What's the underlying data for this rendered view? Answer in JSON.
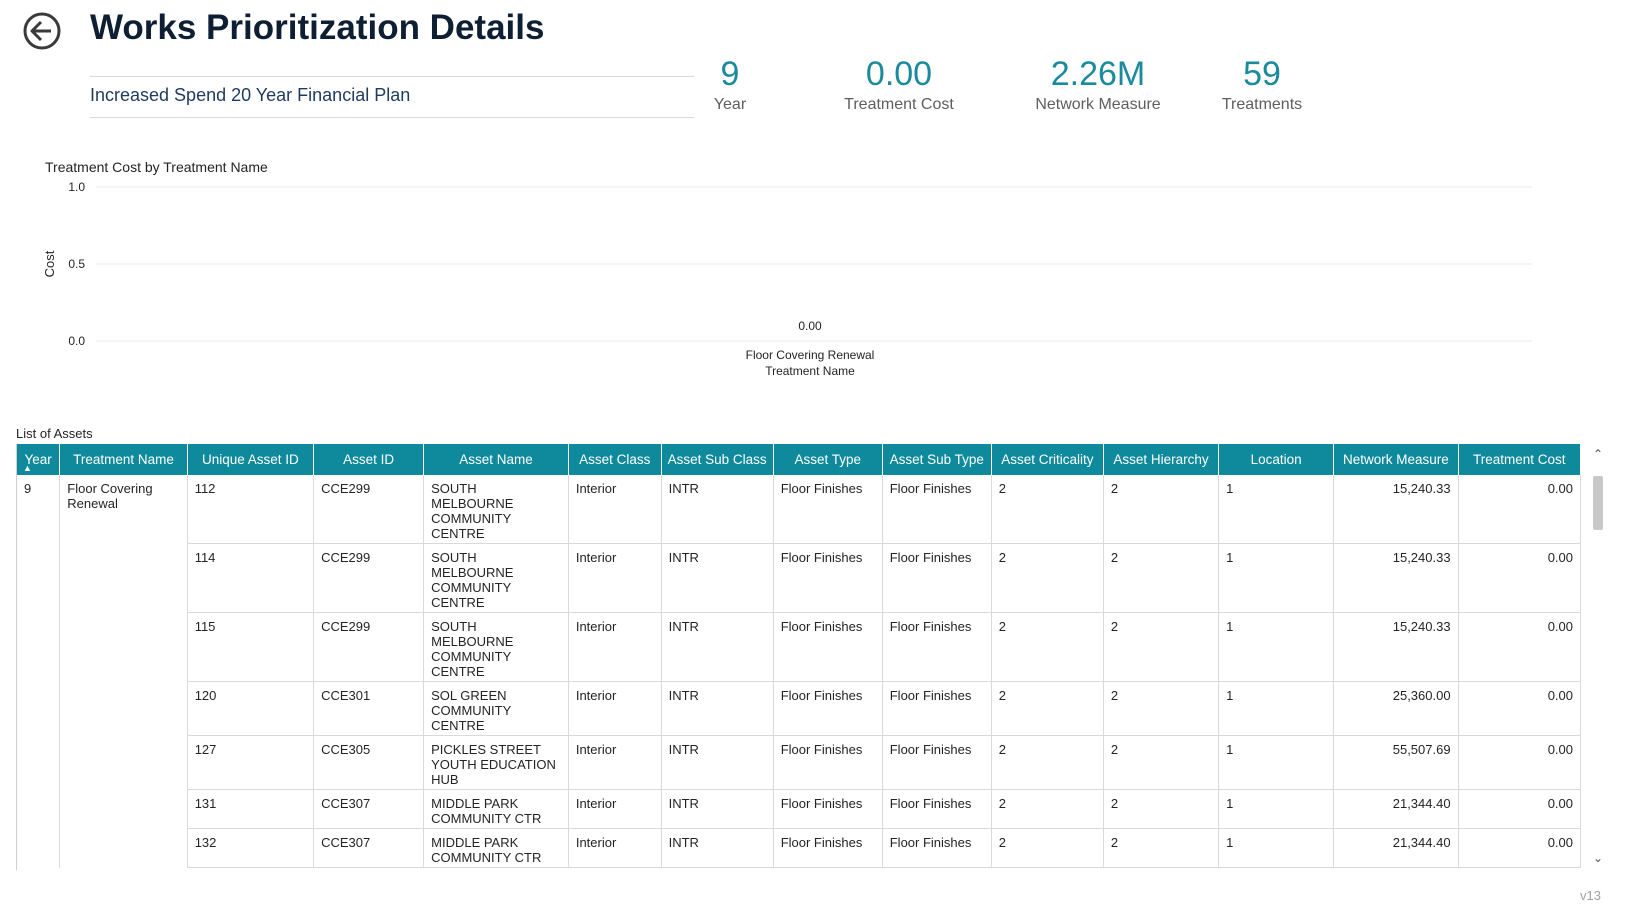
{
  "header": {
    "title": "Works Prioritization Details",
    "back_icon": "arrow-left-circle-icon",
    "scenario": "Increased Spend 20 Year Financial Plan"
  },
  "kpis": [
    {
      "value": "9",
      "label": "Year"
    },
    {
      "value": "0.00",
      "label": "Treatment Cost"
    },
    {
      "value": "2.26M",
      "label": "Network Measure"
    },
    {
      "value": "59",
      "label": "Treatments"
    }
  ],
  "colors": {
    "accent": "#0f8a9d",
    "kpi_value": "#1a8a9d",
    "title": "#0f1f33"
  },
  "chart_data": {
    "type": "bar",
    "title": "Treatment Cost by Treatment Name",
    "xlabel": "Treatment Name",
    "ylabel": "Cost",
    "categories": [
      "Floor Covering Renewal"
    ],
    "values": [
      0.0
    ],
    "data_labels": [
      "0.00"
    ],
    "ylim": [
      0,
      1
    ],
    "yticks": [
      "0.0",
      "0.5",
      "1.0"
    ],
    "grid": true
  },
  "table": {
    "title": "List of Assets",
    "sort_icon": "sort-ascending-icon",
    "columns": [
      "Year",
      "Treatment Name",
      "Unique Asset ID",
      "Asset ID",
      "Asset Name",
      "Asset Class",
      "Asset Sub Class",
      "Asset Type",
      "Asset Sub Type",
      "Asset Criticality",
      "Asset Hierarchy",
      "Location",
      "Network Measure",
      "Treatment Cost"
    ],
    "group": {
      "year": "9",
      "treatment": "Floor Covering Renewal"
    },
    "rows": [
      [
        "112",
        "CCE299",
        "SOUTH MELBOURNE COMMUNITY CENTRE",
        "Interior",
        "INTR",
        "Floor Finishes",
        "Floor Finishes",
        "2",
        "2",
        "1",
        "15,240.33",
        "0.00"
      ],
      [
        "114",
        "CCE299",
        "SOUTH MELBOURNE COMMUNITY CENTRE",
        "Interior",
        "INTR",
        "Floor Finishes",
        "Floor Finishes",
        "2",
        "2",
        "1",
        "15,240.33",
        "0.00"
      ],
      [
        "115",
        "CCE299",
        "SOUTH MELBOURNE COMMUNITY CENTRE",
        "Interior",
        "INTR",
        "Floor Finishes",
        "Floor Finishes",
        "2",
        "2",
        "1",
        "15,240.33",
        "0.00"
      ],
      [
        "120",
        "CCE301",
        "SOL GREEN COMMUNITY CENTRE",
        "Interior",
        "INTR",
        "Floor Finishes",
        "Floor Finishes",
        "2",
        "2",
        "1",
        "25,360.00",
        "0.00"
      ],
      [
        "127",
        "CCE305",
        "PICKLES STREET YOUTH EDUCATION HUB",
        "Interior",
        "INTR",
        "Floor Finishes",
        "Floor Finishes",
        "2",
        "2",
        "1",
        "55,507.69",
        "0.00"
      ],
      [
        "131",
        "CCE307",
        "MIDDLE PARK COMMUNITY CTR",
        "Interior",
        "INTR",
        "Floor Finishes",
        "Floor Finishes",
        "2",
        "2",
        "1",
        "21,344.40",
        "0.00"
      ],
      [
        "132",
        "CCE307",
        "MIDDLE PARK COMMUNITY CTR",
        "Interior",
        "INTR",
        "Floor Finishes",
        "Floor Finishes",
        "2",
        "2",
        "1",
        "21,344.40",
        "0.00"
      ]
    ]
  },
  "scrollbar": {
    "up_icon": "chevron-up-icon",
    "down_icon": "chevron-down-icon"
  },
  "footer": {
    "version": "v13"
  }
}
